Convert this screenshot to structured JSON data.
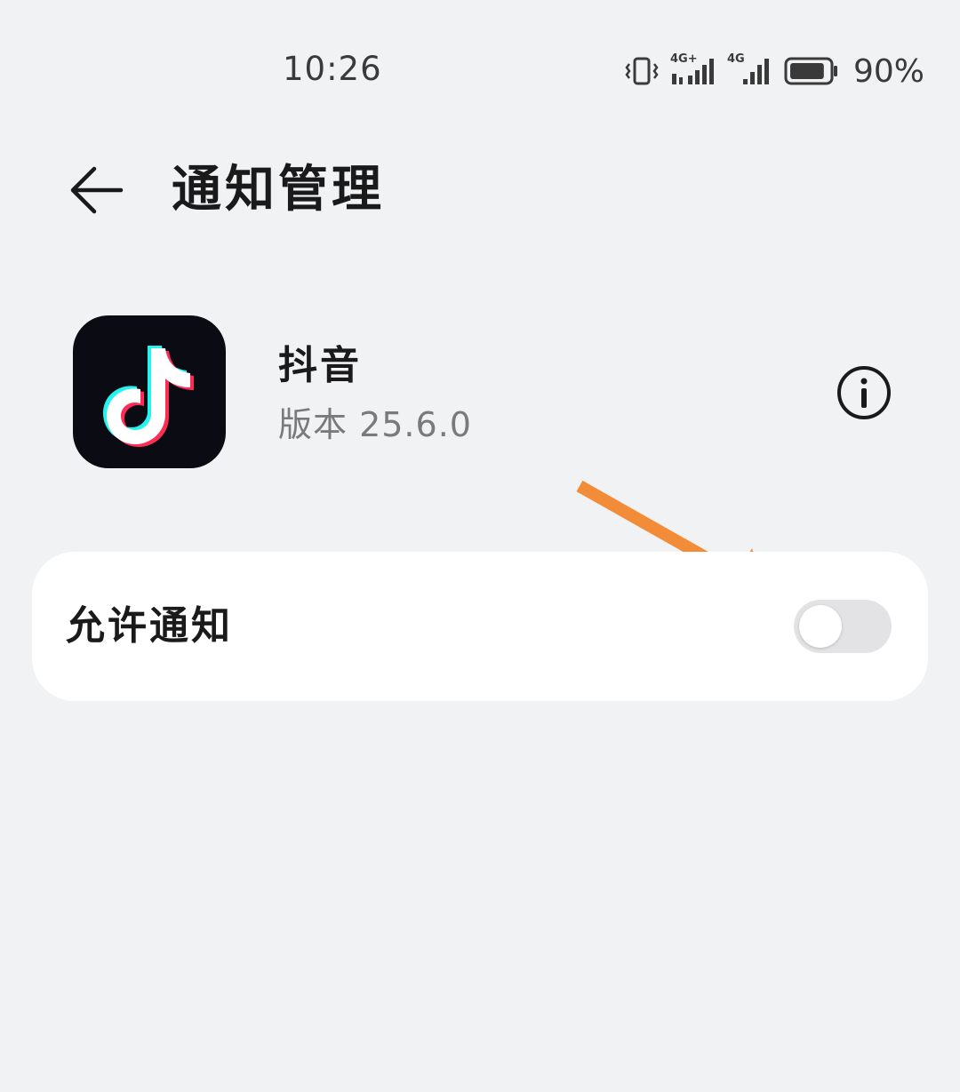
{
  "status_bar": {
    "time": "10:26",
    "signal_1_label": "4G+",
    "signal_2_label": "4G",
    "battery_percent": "90%",
    "battery_level": 0.9
  },
  "header": {
    "title": "通知管理"
  },
  "app": {
    "name": "抖音",
    "version": "版本 25.6.0",
    "icon": "tiktok-note-icon"
  },
  "settings": {
    "allow_notifications": {
      "label": "允许通知",
      "enabled": false
    }
  },
  "colors": {
    "background": "#f1f2f4",
    "card": "#ffffff",
    "annotation_arrow": "#f28c38",
    "toggle_off": "#e3e3e5",
    "app_icon_bg": "#0b0b13",
    "tiktok_cyan": "#25f4ee",
    "tiktok_red": "#fe2c55"
  }
}
